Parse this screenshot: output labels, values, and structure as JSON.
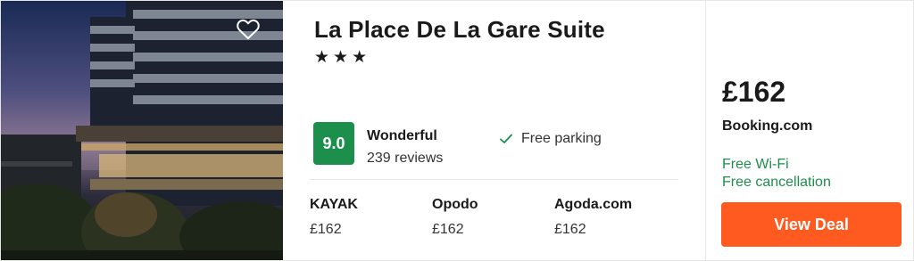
{
  "hotel": {
    "name": "La Place De La Gare Suite",
    "stars": 3,
    "stars_text": "★★★"
  },
  "rating": {
    "score": "9.0",
    "label": "Wonderful",
    "reviews": "239 reviews",
    "badge_color": "#1d8f4d"
  },
  "amenity": {
    "label": "Free parking",
    "icon": "checkmark-icon"
  },
  "providers": [
    {
      "name": "KAYAK",
      "price": "£162"
    },
    {
      "name": "Opodo",
      "price": "£162"
    },
    {
      "name": "Agoda.com",
      "price": "£162"
    }
  ],
  "deal": {
    "price": "£162",
    "seller": "Booking.com",
    "perks": [
      "Free Wi-Fi",
      "Free cancellation"
    ],
    "button_label": "View Deal",
    "button_color": "#ff5a1f",
    "perk_color": "#1d8f4d"
  },
  "icons": {
    "favorite": "heart-outline-icon"
  }
}
